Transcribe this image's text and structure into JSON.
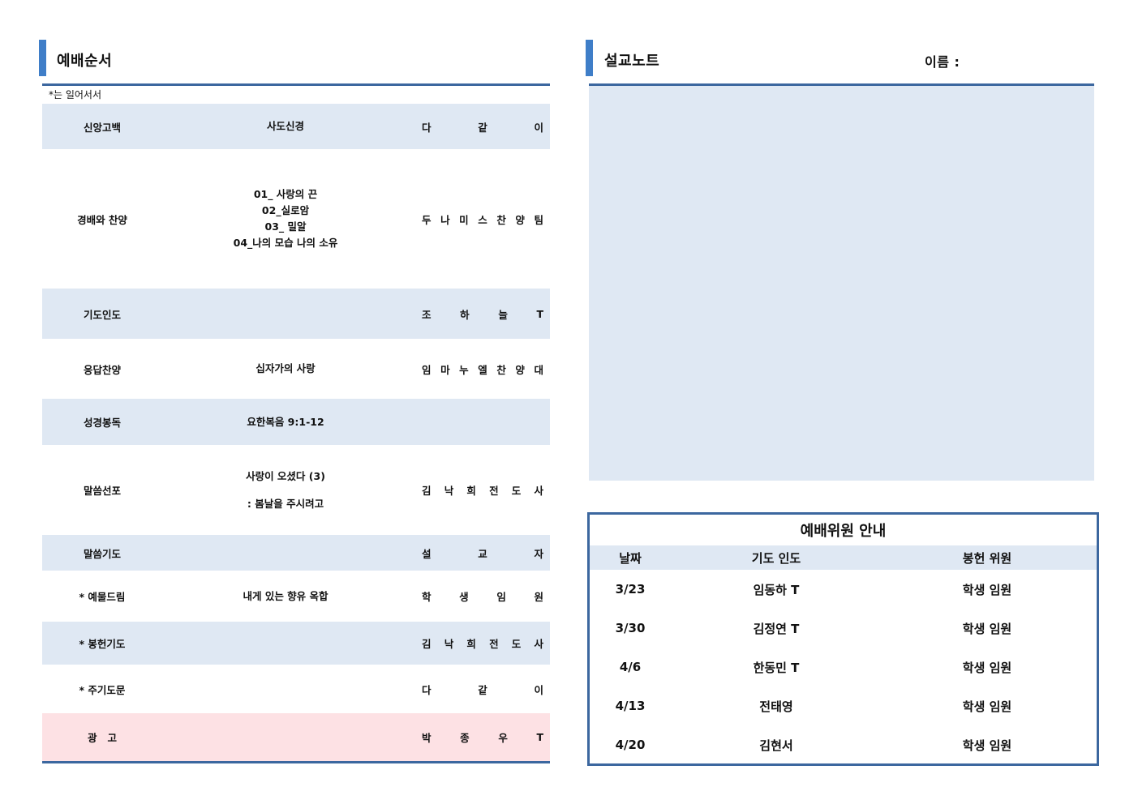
{
  "left": {
    "title": "예배순서",
    "note": "*는 일어서서",
    "rows": [
      {
        "label": "신앙고백",
        "content": [
          "사도신경"
        ],
        "leader": [
          "다",
          "같",
          "이"
        ]
      },
      {
        "label": "경배와 찬양",
        "content": [
          "01_ 사랑의 끈",
          "02_실로암",
          "03_ 밀알",
          "04_나의 모습 나의 소유"
        ],
        "leader": [
          "두",
          "나",
          "미",
          "스",
          "찬",
          "양",
          "팀"
        ]
      },
      {
        "label": "기도인도",
        "content": [],
        "leader": [
          "조",
          "하",
          "늘",
          "T"
        ]
      },
      {
        "label": "응답찬양",
        "content": [
          "십자가의 사랑"
        ],
        "leader": [
          "임",
          "마",
          "누",
          "엘",
          "찬",
          "양",
          "대"
        ]
      },
      {
        "label": "성경봉독",
        "content": [
          "요한복음 9:1-12"
        ],
        "leader": []
      },
      {
        "label": "말씀선포",
        "content": [
          "사랑이 오셨다 (3)",
          "",
          ": 봄날을 주시려고"
        ],
        "leader": [
          "김",
          "낙",
          "희",
          "전",
          "도",
          "사"
        ]
      },
      {
        "label": "말씀기도",
        "content": [],
        "leader": [
          "설",
          "교",
          "자"
        ]
      },
      {
        "label": "* 예물드림",
        "content": [
          "내게 있는 향유 옥합"
        ],
        "leader": [
          "학",
          "생",
          "임",
          "원"
        ]
      },
      {
        "label": "* 봉헌기도",
        "content": [],
        "leader": [
          "김",
          "낙",
          "희",
          "전",
          "도",
          "사"
        ]
      },
      {
        "label": "* 주기도문",
        "content": [],
        "leader": [
          "다",
          "같",
          "이"
        ]
      },
      {
        "label": "광   고",
        "content": [],
        "leader": [
          "박",
          "종",
          "우",
          "T"
        ]
      }
    ]
  },
  "right": {
    "title": "설교노트",
    "name_label": "이름 :",
    "staff": {
      "title": "예배위원 안내",
      "headers": [
        "날짜",
        "기도 인도",
        "봉헌 위원"
      ],
      "rows": [
        [
          "3/23",
          "임동하 T",
          "학생 임원"
        ],
        [
          "3/30",
          "김정연 T",
          "학생 임원"
        ],
        [
          "4/6",
          "한동민 T",
          "학생 임원"
        ],
        [
          "4/13",
          "전태영",
          "학생 임원"
        ],
        [
          "4/20",
          "김현서",
          "학생 임원"
        ]
      ]
    }
  },
  "colors": {
    "accent": "#3f7ec8",
    "rule": "#3c679f",
    "shade": "#dfe8f3",
    "pink": "#fde1e4"
  }
}
